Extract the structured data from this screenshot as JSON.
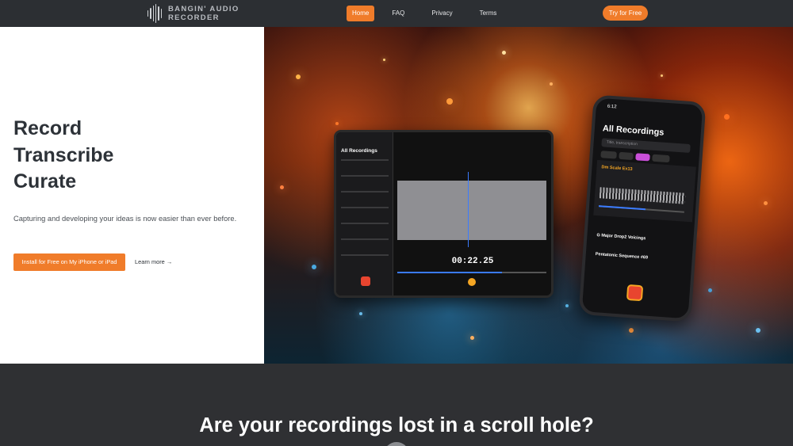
{
  "nav": {
    "logo_line1": "BANGIN' AUDIO",
    "logo_line2": "RECORDER",
    "links": [
      {
        "label": "Home",
        "active": true
      },
      {
        "label": "FAQ",
        "active": false
      },
      {
        "label": "Privacy",
        "active": false
      },
      {
        "label": "Terms",
        "active": false
      }
    ],
    "cta_label": "Try for Free"
  },
  "hero": {
    "headline": [
      "Record",
      "Transcribe",
      "Curate"
    ],
    "subtitle": "Capturing and developing your ideas is now easier than ever before.",
    "install_label": "Install for Free on My iPhone or iPad",
    "learn_more_label": "Learn more →"
  },
  "tablet": {
    "title": "All Recordings",
    "time_readout": "00:22.25",
    "progress_fraction": 0.7
  },
  "phone": {
    "status_time": "6:12",
    "title": "All Recordings",
    "search_placeholder": "Title, transcription",
    "selected_item": "Dm Scale Ex13",
    "items": [
      "G Major Drop2 Voicings",
      "Pentatonic Sequence #69"
    ],
    "progress_fraction": 0.55
  },
  "bottom": {
    "title": "Are your recordings lost in a scroll hole?"
  },
  "colors": {
    "accent": "#f07c2a",
    "nav_bg": "#2c2f33",
    "dark_section": "#2f3033"
  }
}
